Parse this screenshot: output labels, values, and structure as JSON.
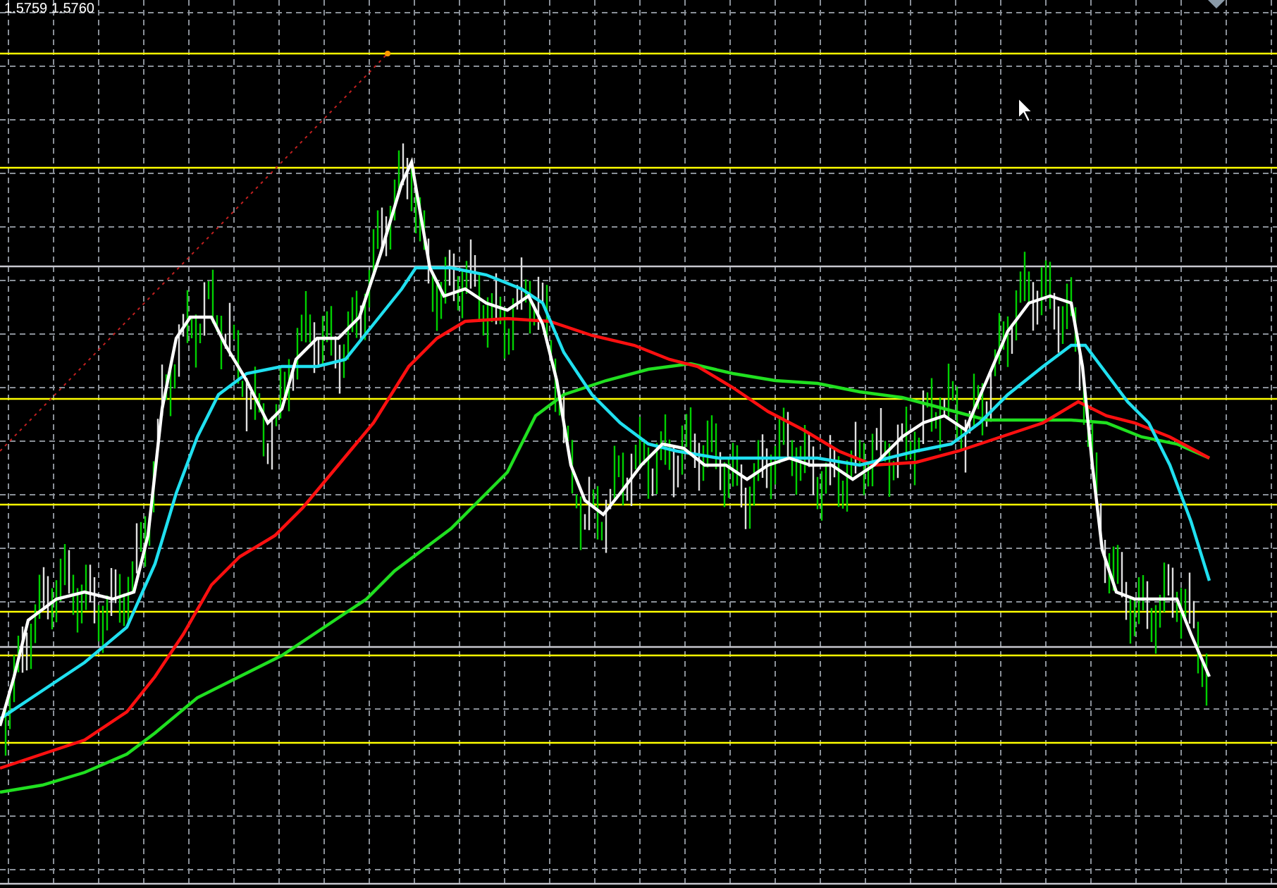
{
  "chart": {
    "price_label": "1.5759 1.5760"
  }
}
